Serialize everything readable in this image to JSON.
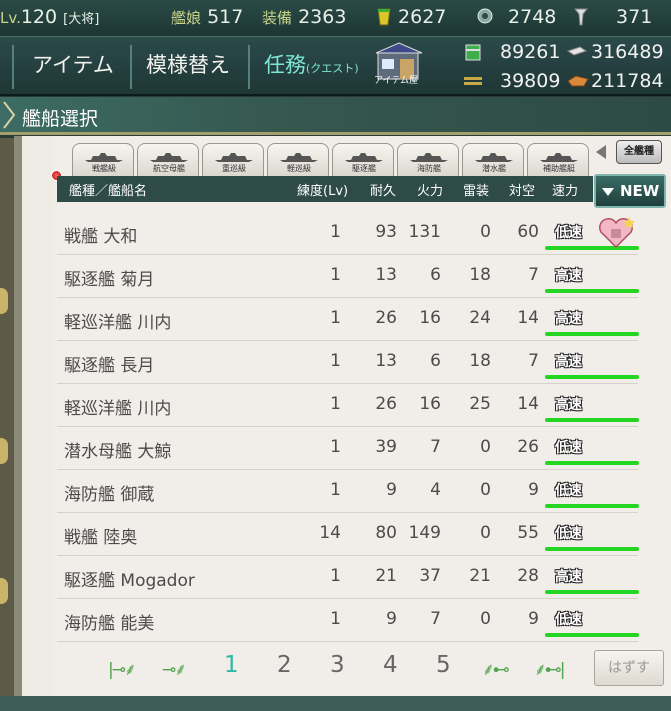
{
  "status": {
    "level_prefix": "Lv.",
    "level": "120",
    "rank": "[大将]",
    "ships_label": "艦娘",
    "ships_count": "517",
    "equip_label": "装備",
    "equip_count": "2363",
    "bucket_count": "2627",
    "devmat_count": "2748",
    "screw_count": "371"
  },
  "menu": {
    "item": "アイテム",
    "remodel": "模様替え",
    "quest": "任務",
    "quest_sub": "(クエスト)",
    "shop": "アイテム屋"
  },
  "resources": {
    "fuel": "89261",
    "steel": "316489",
    "ammo": "39809",
    "bauxite": "211784"
  },
  "title": "艦船選択",
  "tabs": [
    "戦艦級",
    "航空母艦",
    "重巡級",
    "軽巡級",
    "駆逐艦",
    "海防艦",
    "潜水艦",
    "補助艦艇"
  ],
  "all_ships": "全艦種",
  "columns": {
    "name": "艦種／艦船名",
    "level": "練度(Lv)",
    "hp": "耐久",
    "firepower": "火力",
    "torpedo": "雷装",
    "aa": "対空",
    "speed": "速力"
  },
  "sort_button": "NEW",
  "rows": [
    {
      "name": "戦艦 大和",
      "level": "1",
      "hp": "93",
      "fp": "131",
      "torp": "0",
      "aa": "60",
      "speed": "低速",
      "locked": true
    },
    {
      "name": "駆逐艦 菊月",
      "level": "1",
      "hp": "13",
      "fp": "6",
      "torp": "18",
      "aa": "7",
      "speed": "高速"
    },
    {
      "name": "軽巡洋艦 川内",
      "level": "1",
      "hp": "26",
      "fp": "16",
      "torp": "24",
      "aa": "14",
      "speed": "高速"
    },
    {
      "name": "駆逐艦 長月",
      "level": "1",
      "hp": "13",
      "fp": "6",
      "torp": "18",
      "aa": "7",
      "speed": "高速"
    },
    {
      "name": "軽巡洋艦 川内",
      "level": "1",
      "hp": "26",
      "fp": "16",
      "torp": "25",
      "aa": "14",
      "speed": "高速"
    },
    {
      "name": "潜水母艦 大鯨",
      "level": "1",
      "hp": "39",
      "fp": "7",
      "torp": "0",
      "aa": "26",
      "speed": "低速"
    },
    {
      "name": "海防艦 御蔵",
      "level": "1",
      "hp": "9",
      "fp": "4",
      "torp": "0",
      "aa": "9",
      "speed": "低速"
    },
    {
      "name": "戦艦 陸奥",
      "level": "14",
      "hp": "80",
      "fp": "149",
      "torp": "0",
      "aa": "55",
      "speed": "低速"
    },
    {
      "name": "駆逐艦 Mogador",
      "level": "1",
      "hp": "21",
      "fp": "37",
      "torp": "21",
      "aa": "28",
      "speed": "高速"
    },
    {
      "name": "海防艦 能美",
      "level": "1",
      "hp": "9",
      "fp": "7",
      "torp": "0",
      "aa": "9",
      "speed": "低速"
    }
  ],
  "pagination": {
    "pages": [
      "1",
      "2",
      "3",
      "4",
      "5"
    ],
    "current": "1",
    "remove_label": "はずす"
  }
}
